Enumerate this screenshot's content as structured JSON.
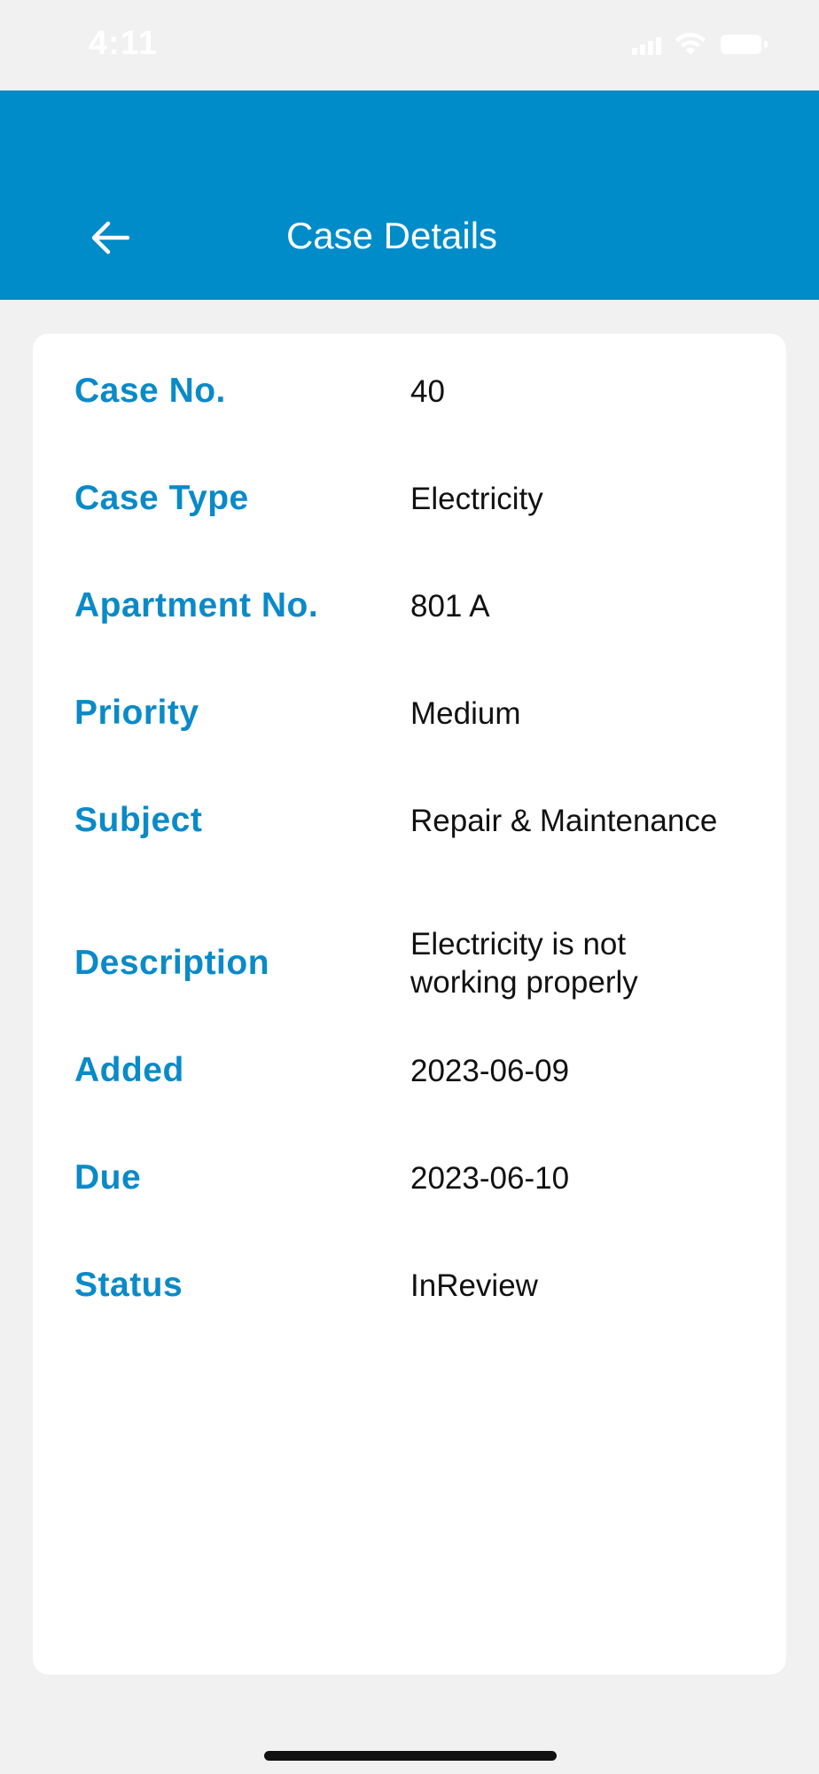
{
  "status_bar": {
    "time": "4:11"
  },
  "header": {
    "title": "Case Details",
    "background_color": "#008bc9",
    "back_icon": "arrow-left-icon"
  },
  "details": [
    {
      "label": "Case No.",
      "value": "40"
    },
    {
      "label": "Case Type",
      "value": "Electricity"
    },
    {
      "label": "Apartment No.",
      "value": "801 A"
    },
    {
      "label": "Priority",
      "value": "Medium"
    },
    {
      "label": "Subject",
      "value": "Repair & Maintenance"
    },
    {
      "label": "Description",
      "value": "Electricity is not working properly"
    },
    {
      "label": "Added",
      "value": "2023-06-09"
    },
    {
      "label": "Due",
      "value": "2023-06-10"
    },
    {
      "label": "Status",
      "value": "InReview"
    }
  ],
  "colors": {
    "label": "#0a8ac8",
    "value": "#111111",
    "page_background": "#f1f1f1",
    "card_background": "#ffffff"
  }
}
